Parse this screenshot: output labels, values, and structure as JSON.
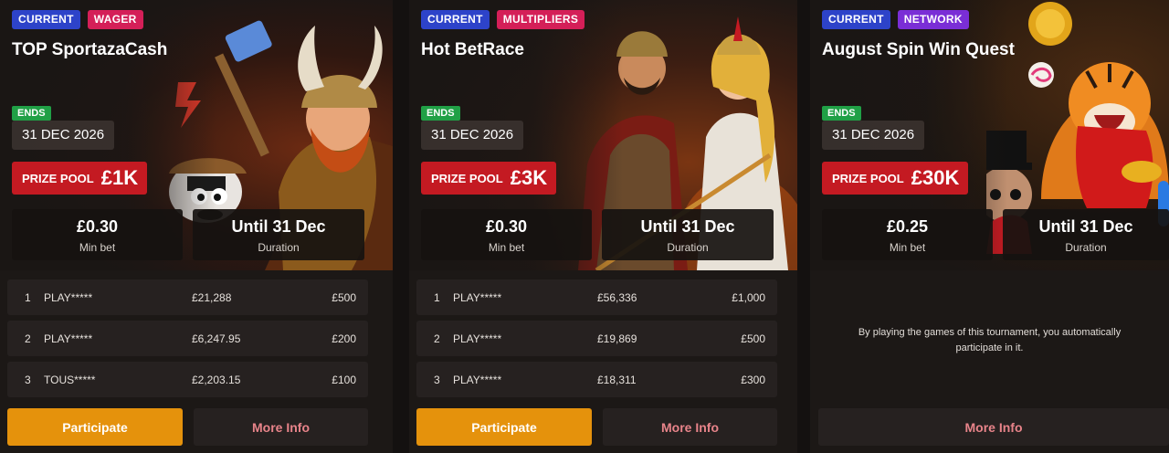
{
  "cards": [
    {
      "tags": [
        "CURRENT",
        "WAGER"
      ],
      "title": "TOP SportazaCash",
      "ends_label": "ENDS",
      "ends_date": "31 DEC 2026",
      "prize_label": "PRIZE POOL",
      "prize_value": "£1K",
      "min_bet_value": "£0.30",
      "min_bet_label": "Min bet",
      "duration_value": "Until 31 Dec",
      "duration_label": "Duration",
      "leaderboard": [
        {
          "rank": "1",
          "player": "PLAY*****",
          "score": "£21,288",
          "prize": "£500"
        },
        {
          "rank": "2",
          "player": "PLAY*****",
          "score": "£6,247.95",
          "prize": "£200"
        },
        {
          "rank": "3",
          "player": "TOUS*****",
          "score": "£2,203.15",
          "prize": "£100"
        }
      ],
      "participate_label": "Participate",
      "more_info_label": "More Info"
    },
    {
      "tags": [
        "CURRENT",
        "MULTIPLIERS"
      ],
      "title": "Hot BetRace",
      "ends_label": "ENDS",
      "ends_date": "31 DEC 2026",
      "prize_label": "PRIZE POOL",
      "prize_value": "£3K",
      "min_bet_value": "£0.30",
      "min_bet_label": "Min bet",
      "duration_value": "Until 31 Dec",
      "duration_label": "Duration",
      "leaderboard": [
        {
          "rank": "1",
          "player": "PLAY*****",
          "score": "£56,336",
          "prize": "£1,000"
        },
        {
          "rank": "2",
          "player": "PLAY*****",
          "score": "£19,869",
          "prize": "£500"
        },
        {
          "rank": "3",
          "player": "PLAY*****",
          "score": "£18,311",
          "prize": "£300"
        }
      ],
      "participate_label": "Participate",
      "more_info_label": "More Info"
    },
    {
      "tags": [
        "CURRENT",
        "NETWORK"
      ],
      "title": "August Spin Win Quest",
      "ends_label": "ENDS",
      "ends_date": "31 DEC 2026",
      "prize_label": "PRIZE POOL",
      "prize_value": "£30K",
      "min_bet_value": "£0.25",
      "min_bet_label": "Min bet",
      "duration_value": "Until 31 Dec",
      "duration_label": "Duration",
      "info_text": "By playing the games of this tournament, you automatically participate in it.",
      "more_info_label": "More Info"
    }
  ],
  "colors": {
    "current_tag": "#2d43c9",
    "category_tag_pink": "#d41f58",
    "network_tag": "#7a2ed6",
    "ends_badge": "#20a046",
    "prize_pool": "#c41a22",
    "participate": "#e5920c",
    "more_info_text": "#e8848a"
  },
  "icons": [
    "viking-art",
    "gladiator-art",
    "tiger-art"
  ]
}
